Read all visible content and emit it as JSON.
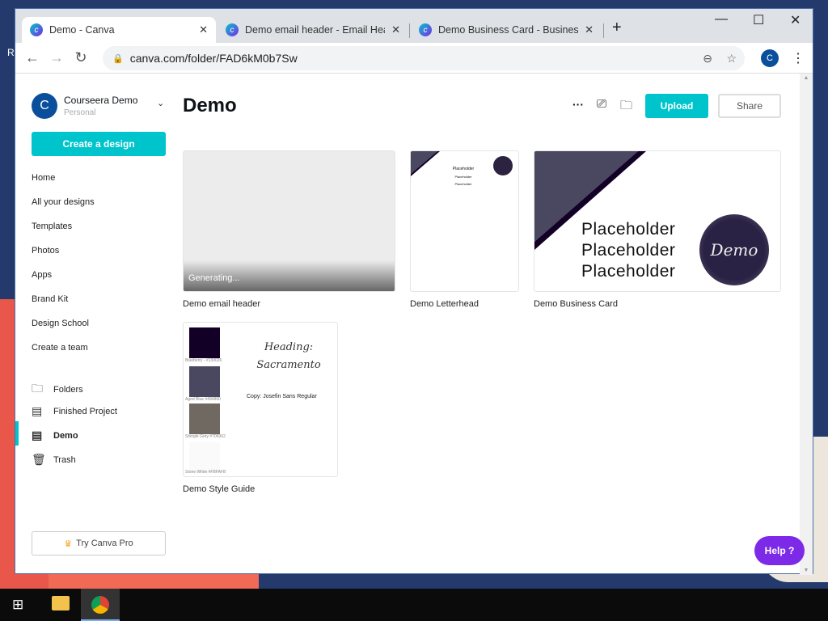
{
  "desktop": {
    "partial_label": "R"
  },
  "browser": {
    "tabs": [
      {
        "title": "Demo - Canva",
        "active": true
      },
      {
        "title": "Demo email header - Email Head"
      },
      {
        "title": "Demo Business Card - Business C"
      }
    ],
    "url": "canva.com/folder/FAD6kM0b7Sw",
    "profile_initial": "C"
  },
  "sidebar": {
    "account": {
      "initial": "C",
      "name": "Courseera Demo",
      "type": "Personal"
    },
    "create_label": "Create a design",
    "nav": [
      "Home",
      "All your designs",
      "Templates",
      "Photos",
      "Apps",
      "Brand Kit",
      "Design School",
      "Create a team"
    ],
    "folders": [
      {
        "label": "Folders",
        "icon": "folder-icon"
      },
      {
        "label": "Finished Project",
        "icon": "thumb-icon"
      },
      {
        "label": "Demo",
        "icon": "thumb-icon",
        "active": true
      },
      {
        "label": "Trash",
        "icon": "trash-icon"
      }
    ],
    "pro_label": "Try Canva Pro"
  },
  "main": {
    "title": "Demo",
    "upload_label": "Upload",
    "share_label": "Share",
    "designs": [
      {
        "name": "Demo email header",
        "status": "Generating..."
      },
      {
        "name": "Demo Letterhead",
        "lines": [
          "Placeholder",
          "Placeholder",
          "Placeholder"
        ]
      },
      {
        "name": "Demo Business Card",
        "lines": [
          "Placeholder",
          "Placeholder",
          "Placeholder"
        ],
        "logo": "Demo"
      },
      {
        "name": "Demo Style Guide",
        "heading": "Heading:",
        "heading2": "Sacramento",
        "copy": "Copy: Josefin Sans Regular",
        "swatches": [
          {
            "label": "Blueberry - #130026",
            "color": "#130026"
          },
          {
            "label": "Aged Blue #494860",
            "color": "#494860"
          },
          {
            "label": "Shingle Grey #706962",
            "color": "#706962"
          },
          {
            "label": "Stone White #FBFAFB",
            "color": "#FBFAFB"
          }
        ]
      }
    ],
    "help_label": "Help ?"
  }
}
